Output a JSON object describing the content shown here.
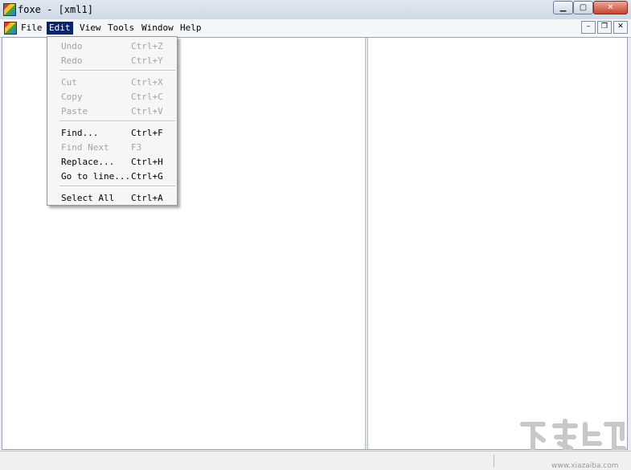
{
  "window": {
    "title": "foxe - [xml1]",
    "minimize": "▁",
    "maximize": "▢",
    "close": "✕"
  },
  "menubar": {
    "items": [
      {
        "label": "File"
      },
      {
        "label": "Edit"
      },
      {
        "label": "View"
      },
      {
        "label": "Tools"
      },
      {
        "label": "Window"
      },
      {
        "label": "Help"
      }
    ],
    "active": "Edit",
    "mdi": {
      "minimize": "–",
      "restore": "❐",
      "close": "✕"
    }
  },
  "edit_menu": {
    "items": [
      {
        "label": "Undo",
        "shortcut": "Ctrl+Z",
        "enabled": false
      },
      {
        "label": "Redo",
        "shortcut": "Ctrl+Y",
        "enabled": false
      },
      {
        "label": "Cut",
        "shortcut": "Ctrl+X",
        "enabled": false
      },
      {
        "label": "Copy",
        "shortcut": "Ctrl+C",
        "enabled": false
      },
      {
        "label": "Paste",
        "shortcut": "Ctrl+V",
        "enabled": false
      },
      {
        "label": "Find...",
        "shortcut": "Ctrl+F",
        "enabled": true
      },
      {
        "label": "Find Next",
        "shortcut": "F3",
        "enabled": false
      },
      {
        "label": "Replace...",
        "shortcut": "Ctrl+H",
        "enabled": true
      },
      {
        "label": "Go to line...",
        "shortcut": "Ctrl+G",
        "enabled": true
      },
      {
        "label": "Select All",
        "shortcut": "Ctrl+A",
        "enabled": true
      }
    ]
  },
  "watermark": {
    "text": "www.xiazaiba.com"
  },
  "colors": {
    "menu_highlight": "#0a246a",
    "disabled_text": "#a4a4a4"
  }
}
